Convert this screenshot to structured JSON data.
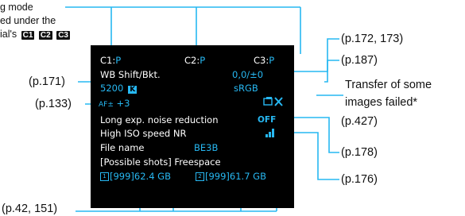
{
  "caption": {
    "line1": "g mode",
    "line2": "ed under the",
    "line3_text": "ial's",
    "badges": [
      "C1",
      "C2",
      "C3"
    ]
  },
  "screen": {
    "c1": "C1:",
    "c1_val": "P",
    "c2": "C2:",
    "c2_val": "P",
    "c3": "C3:",
    "c3_val": "P",
    "wb_label": "WB Shift/Bkt.",
    "wb_value": "0,0/±0",
    "kelvin": "5200",
    "kelvin_badge": "K",
    "color_space": "sRGB",
    "af_value": "+3",
    "long_exp_label": "Long exp. noise reduction",
    "long_exp_value": "OFF",
    "iso_nr_label": "High ISO speed NR",
    "file_name_label": "File name",
    "file_name_value": "BE3B",
    "possible_shots": "[Possible shots] Freespace",
    "card1_badge": "1",
    "card1_value": "[999]62.4 GB",
    "card2_badge": "2",
    "card2_value": "[999]61.7 GB"
  },
  "refs": {
    "p172": "(p.172, 173)",
    "p187": "(p.187)",
    "p171": "(p.171)",
    "transfer1": "Transfer of some",
    "transfer2": "images failed*",
    "p133": "(p.133)",
    "p427": "(p.427)",
    "p178": "(p.178)",
    "p176": "(p.176)",
    "p42": "(p.42, 151)"
  },
  "colors": {
    "accent": "#27b8f2",
    "screen_bg": "#000000",
    "line": "#27b8f2"
  }
}
